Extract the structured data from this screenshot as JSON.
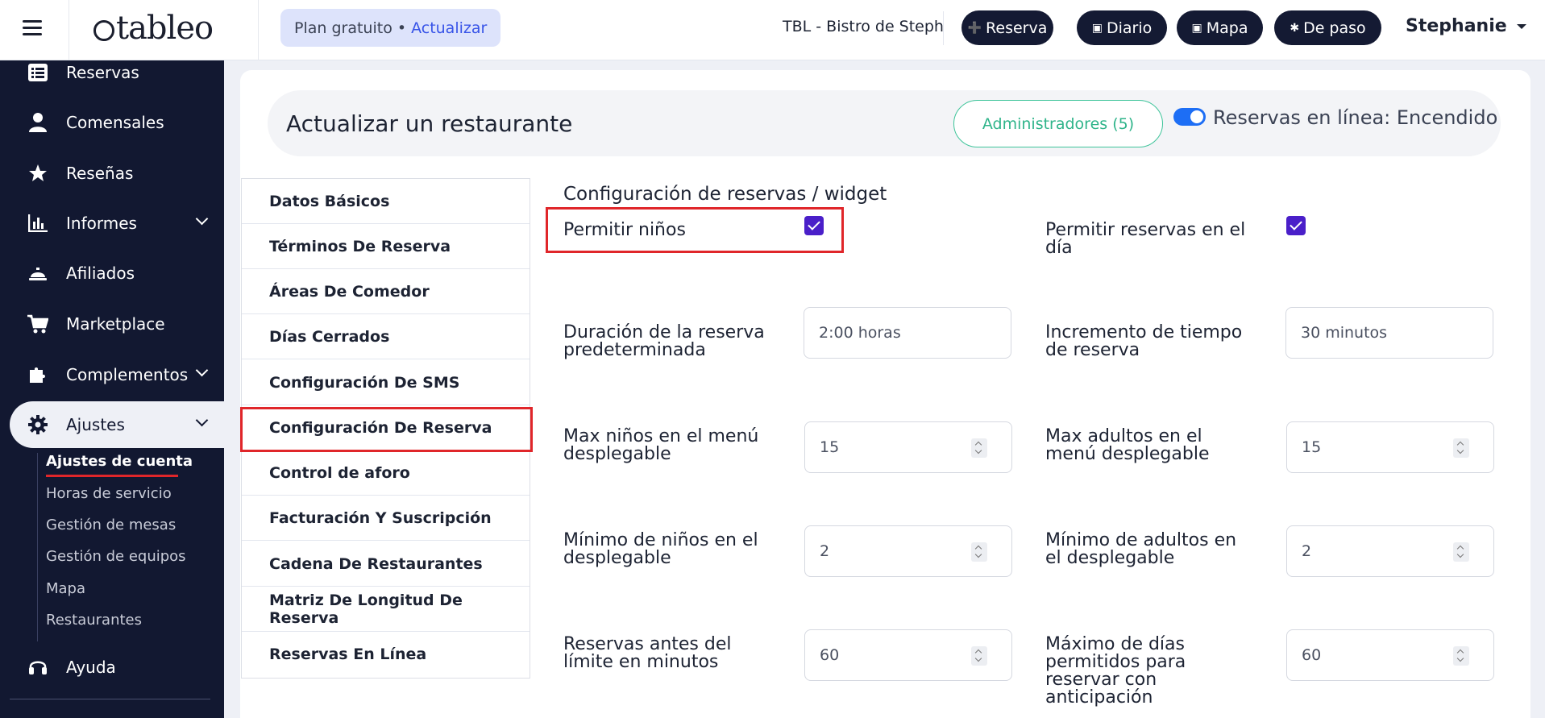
{
  "topbar": {
    "logo_text": "tableo",
    "plan": {
      "text": "Plan gratuito •",
      "upgrade": "Actualizar"
    },
    "restaurant": "TBL - Bistro de Steph",
    "buttons": [
      {
        "label": "Reserva",
        "icon": "plus-circle-icon"
      },
      {
        "label": "Diario",
        "icon": "calendar-icon"
      },
      {
        "label": "Mapa",
        "icon": "map-icon"
      },
      {
        "label": "De paso",
        "icon": "walk-icon"
      }
    ],
    "user": "Stephanie"
  },
  "sidebar": {
    "items": [
      {
        "label": "Reservas",
        "icon": "list-icon"
      },
      {
        "label": "Comensales",
        "icon": "user-icon"
      },
      {
        "label": "Reseñas",
        "icon": "star-icon"
      },
      {
        "label": "Informes",
        "icon": "chart-icon"
      },
      {
        "label": "Afiliados",
        "icon": "bell-service-icon"
      },
      {
        "label": "Marketplace",
        "icon": "cart-icon"
      },
      {
        "label": "Complementos",
        "icon": "puzzle-icon"
      },
      {
        "label": "Ajustes",
        "icon": "gear-icon"
      },
      {
        "label": "Ayuda",
        "icon": "headset-icon"
      }
    ],
    "sub_items": [
      "Ajustes de cuenta",
      "Horas de servicio",
      "Gestión de mesas",
      "Gestión de equipos",
      "Mapa",
      "Restaurantes"
    ]
  },
  "header": {
    "title": "Actualizar un restaurante",
    "admins_button": "Administradores (5)",
    "online_label": "Reservas en línea: Encendido",
    "online_enabled": true
  },
  "menu": [
    "Datos Básicos",
    "Términos De Reserva",
    "Áreas De Comedor",
    "Días Cerrados",
    "Configuración De SMS",
    "Configuración De Reserva",
    "Control de aforo",
    "Facturación Y Suscripción",
    "Cadena De Restaurantes",
    "Matriz De Longitud De Reserva",
    "Reservas En Línea"
  ],
  "form": {
    "section_title": "Configuración de reservas / widget",
    "allow_children": {
      "label": "Permitir niños",
      "checked": true
    },
    "allow_same_day": {
      "label_1": "Permitir reservas en el",
      "label_2": "día",
      "checked": true
    },
    "default_duration": {
      "label_1": "Duración de la reserva",
      "label_2": "predeterminada",
      "value": "2:00 horas"
    },
    "time_increment": {
      "label_1": "Incremento de tiempo",
      "label_2": "de reserva",
      "value": "30 minutos"
    },
    "max_children": {
      "label_1": "Max niños en el menú",
      "label_2": "desplegable",
      "value": "15"
    },
    "max_adults": {
      "label_1": "Max adultos en el",
      "label_2": "menú desplegable",
      "value": "15"
    },
    "min_children": {
      "label_1": "Mínimo de niños en el",
      "label_2": "desplegable",
      "value": "2"
    },
    "min_adults": {
      "label_1": "Mínimo de adultos en",
      "label_2": "el desplegable",
      "value": "2"
    },
    "cutoff_minutes": {
      "label_1": "Reservas antes del",
      "label_2": "límite en minutos",
      "value": "60"
    },
    "max_days_advance": {
      "label_1": "Máximo de días",
      "label_2": "permitidos para",
      "label_3": "reservar con",
      "label_4": "anticipación",
      "value": "60"
    }
  },
  "colors": {
    "sidebar_bg": "#121831",
    "accent_blue": "#3854e8",
    "checkbox": "#4a1fc9",
    "highlight_red": "#e0262a",
    "admins_green": "#3ec49a"
  }
}
